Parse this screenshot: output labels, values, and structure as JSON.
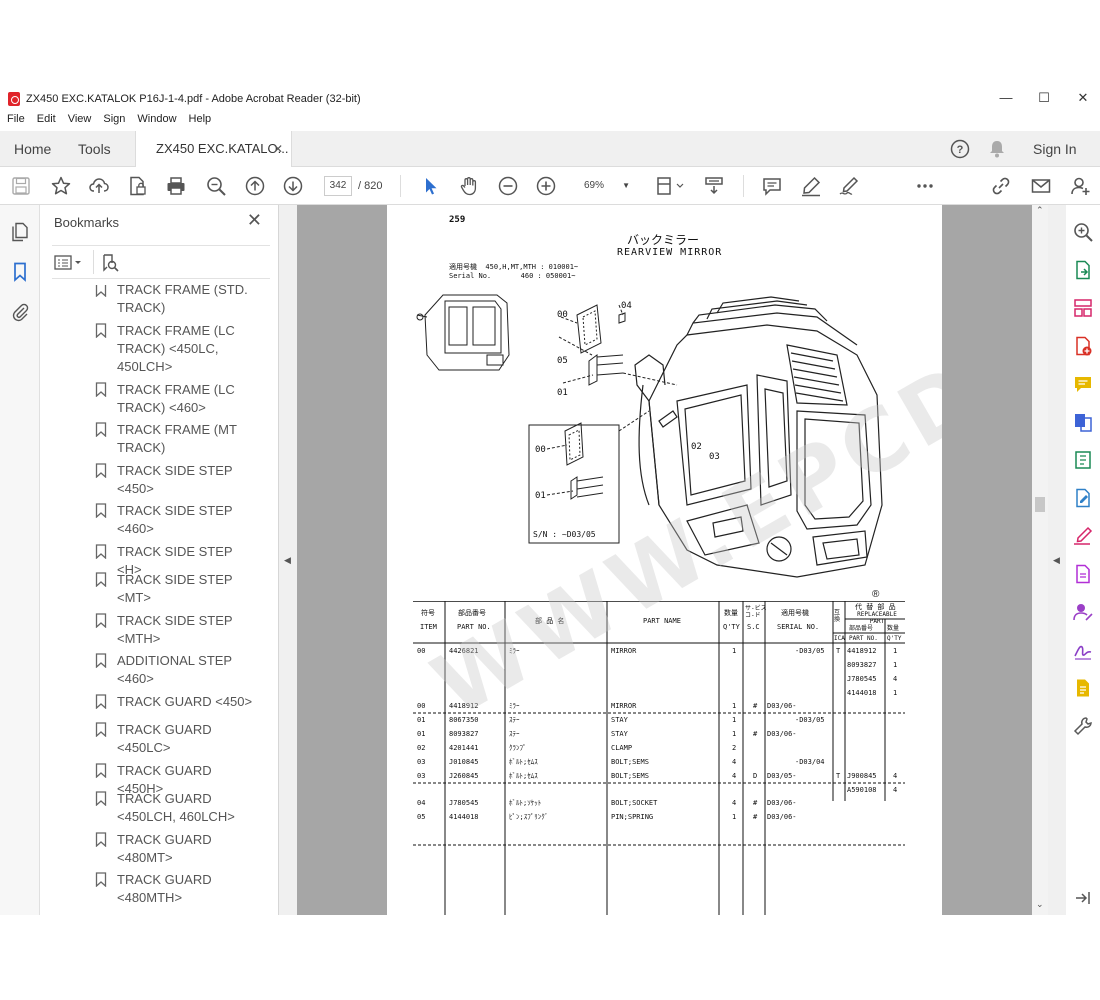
{
  "window": {
    "title": "ZX450 EXC.KATALOK P16J-1-4.pdf - Adobe Acrobat Reader (32-bit)",
    "controls": [
      "—",
      "☐",
      "✕"
    ]
  },
  "menu": [
    "File",
    "Edit",
    "View",
    "Sign",
    "Window",
    "Help"
  ],
  "tabs": {
    "home": "Home",
    "tools": "Tools",
    "document": "ZX450 EXC.KATALO...",
    "sign_in": "Sign In"
  },
  "toolbar": {
    "page_current": "342",
    "page_total": "/  820",
    "zoom": "69%"
  },
  "bookmarks": {
    "header": "Bookmarks",
    "items": [
      "TRACK FRAME (STD. TRACK)",
      "TRACK FRAME (LC TRACK) <450LC, 450LCH>",
      "TRACK FRAME (LC TRACK) <460>",
      "TRACK FRAME (MT TRACK)",
      "TRACK SIDE STEP <450>",
      "TRACK SIDE STEP <460>",
      "TRACK SIDE STEP <H>",
      "TRACK SIDE STEP <MT>",
      "TRACK SIDE STEP <MTH>",
      "ADDITIONAL STEP <460>",
      "TRACK GUARD <450>",
      "TRACK GUARD <450LC>",
      "TRACK GUARD <450H>",
      "TRACK GUARD <450LCH, 460LCH>",
      "TRACK GUARD <480MT>",
      "TRACK GUARD <480MTH>"
    ]
  },
  "document": {
    "page_number": "259",
    "title_jp": "バックミラー",
    "title_en": "REARVIEW MIRROR",
    "serial_block": "適用号機  450,H,MT,MTH : 010001~\nSerial No.       460 : 050001~",
    "inset_serial": "S/N : ~D03/05",
    "registered": "®",
    "callouts": {
      "c00a": "00",
      "c04": "04",
      "c05": "05",
      "c01a": "01",
      "c02": "02",
      "c03": "03",
      "c00b": "00",
      "c01b": "01"
    },
    "table_headers": {
      "item_jp": "符号",
      "item_en": "ITEM",
      "partno_jp": "部品番号",
      "partno_en": "PART NO.",
      "name_jp": "部 品 名",
      "name_en": "PART NAME",
      "qty_jp": "数量",
      "qty_en": "Q'TY",
      "sc_jp": "サ-ビス\nコ-ド",
      "sc_en": "S.C",
      "serial_jp": "適用号機",
      "serial_en": "SERIAL NO.",
      "ica_jp": "互換",
      "ica_en": "ICA",
      "repl_jp": "代 替 部 品",
      "repl_en": "REPLACEABLE PART",
      "repl_partno_jp": "部品番号",
      "repl_partno_en": "PART NO.",
      "repl_qty_jp": "数量",
      "repl_qty_en": "Q'TY"
    },
    "rows": [
      {
        "item": "00",
        "part": "4426821",
        "jp": "ﾐﾗｰ",
        "name": "MIRROR",
        "qty": "1",
        "sc": "",
        "serial": "-D03/05",
        "ica": "T",
        "repl": [
          "4418912",
          "8093827",
          "J780545",
          "4144018"
        ],
        "repl_qty": [
          "1",
          "1",
          "4",
          "1"
        ]
      },
      {
        "item": "00",
        "part": "4418912",
        "jp": "ﾐﾗｰ",
        "name": "MIRROR",
        "qty": "1",
        "sc": "#",
        "serial": "D03/06-",
        "ica": "",
        "repl": [],
        "repl_qty": []
      },
      {
        "item": "01",
        "part": "8067350",
        "jp": "ｽﾃｰ",
        "name": "STAY",
        "qty": "1",
        "sc": "",
        "serial": "-D03/05",
        "ica": "",
        "repl": [],
        "repl_qty": []
      },
      {
        "item": "01",
        "part": "8093827",
        "jp": "ｽﾃｰ",
        "name": "STAY",
        "qty": "1",
        "sc": "#",
        "serial": "D03/06-",
        "ica": "",
        "repl": [],
        "repl_qty": []
      },
      {
        "item": "02",
        "part": "4201441",
        "jp": "ｸﾗﾝﾌﾟ",
        "name": "CLAMP",
        "qty": "2",
        "sc": "",
        "serial": "",
        "ica": "",
        "repl": [],
        "repl_qty": []
      },
      {
        "item": "03",
        "part": "J010845",
        "jp": "ﾎﾞﾙﾄ;ｾﾑｽ",
        "name": "BOLT;SEMS",
        "qty": "4",
        "sc": "",
        "serial": "-D03/04",
        "ica": "",
        "repl": [],
        "repl_qty": []
      },
      {
        "item": "03",
        "part": "J260845",
        "jp": "ﾎﾞﾙﾄ;ｾﾑｽ",
        "name": "BOLT;SEMS",
        "qty": "4",
        "sc": "D",
        "serial": "D03/05-",
        "ica": "T",
        "repl": [
          "J900845",
          "A590108"
        ],
        "repl_qty": [
          "4",
          "4"
        ]
      },
      {
        "item": "04",
        "part": "J780545",
        "jp": "ﾎﾞﾙﾄ;ｿｹｯﾄ",
        "name": "BOLT;SOCKET",
        "qty": "4",
        "sc": "#",
        "serial": "D03/06-",
        "ica": "",
        "repl": [],
        "repl_qty": []
      },
      {
        "item": "05",
        "part": "4144018",
        "jp": "ﾋﾟﾝ;ｽﾌﾟﾘﾝｸﾞ",
        "name": "PIN;SPRING",
        "qty": "1",
        "sc": "#",
        "serial": "D03/06-",
        "ica": "",
        "repl": [],
        "repl_qty": []
      }
    ]
  },
  "watermark": "WWW.EPCDATA.COM",
  "colors": {
    "accent": "#2d6fcf",
    "viewer_bg": "#a6a6a6",
    "icon_gray": "#5a5a5a",
    "pdf_red": "#e0242a",
    "right_rail": [
      "#1a8a55",
      "#d6266a",
      "#d93025",
      "#e7b800",
      "#3d63d6",
      "#1a8a55",
      "#2f80c7",
      "#d6266a",
      "#b12fd6",
      "#9b3fc7",
      "#8b3fc7",
      "#e7b800",
      "#5a5a5a"
    ]
  }
}
